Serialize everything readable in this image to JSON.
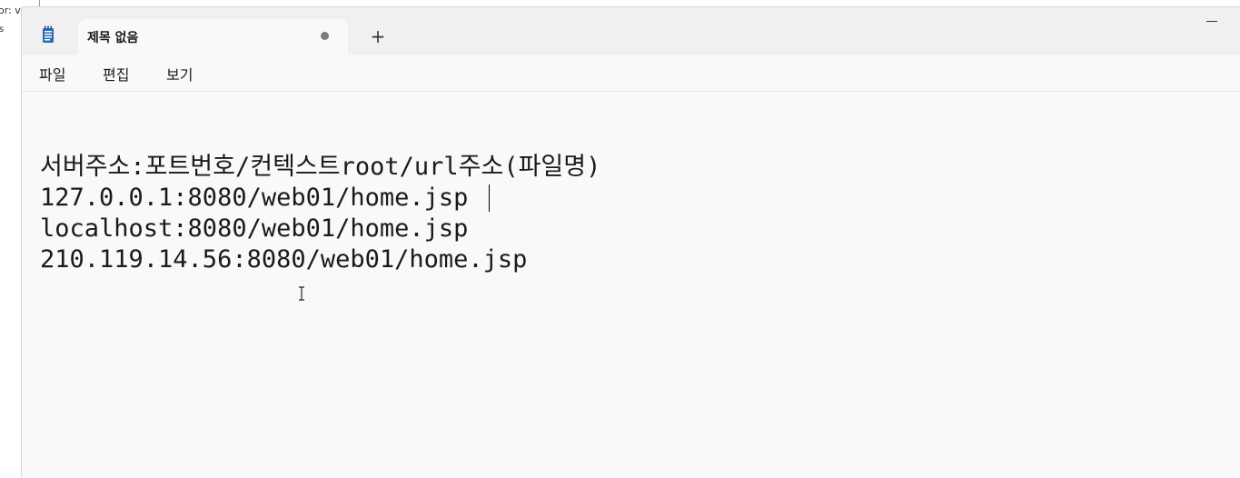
{
  "background": {
    "snippet": "or: v",
    "mark": "s"
  },
  "window": {
    "tab_title": "제목 없음",
    "new_tab_label": "+",
    "menu": [
      {
        "label": "파일"
      },
      {
        "label": "편집"
      },
      {
        "label": "보기"
      }
    ],
    "editor_lines": [
      "서버주소:포트번호/컨텍스트root/url주소(파일명)",
      "127.0.0.1:8080/web01/home.jsp",
      "localhost:8080/web01/home.jsp",
      "210.119.14.56:8080/web01/home.jsp"
    ]
  },
  "icons": {
    "app": "notepad-icon",
    "unsaved": "unsaved-dot-icon",
    "new_tab": "plus-icon",
    "minimize": "minimize-icon",
    "cursor": "text-cursor-icon"
  },
  "colors": {
    "titlebar": "#f0f0f0",
    "editor_bg": "#f9f9f9",
    "icon_accent": "#2b6cb0"
  }
}
